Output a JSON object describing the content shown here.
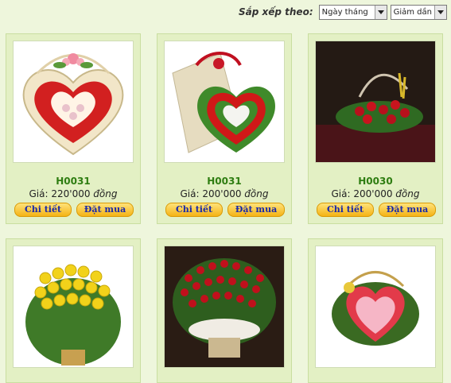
{
  "sort": {
    "label": "Sắp xếp theo:",
    "field_value": "Ngày tháng",
    "order_value": "Giảm dần"
  },
  "labels": {
    "price_prefix": "Giá:",
    "currency": "đồng",
    "details_button": "Chi tiết",
    "order_button": "Đặt mua"
  },
  "products": [
    {
      "code": "H0031",
      "price": "220'000",
      "image": "heart-rose-box"
    },
    {
      "code": "H0031",
      "price": "200'000",
      "image": "heart-rose-wreath-gift"
    },
    {
      "code": "H0030",
      "price": "200'000",
      "image": "red-rose-basket"
    },
    {
      "image": "yellow-rose-bouquet"
    },
    {
      "image": "red-rose-basket-tall"
    },
    {
      "image": "pink-rose-heart-basket"
    }
  ]
}
